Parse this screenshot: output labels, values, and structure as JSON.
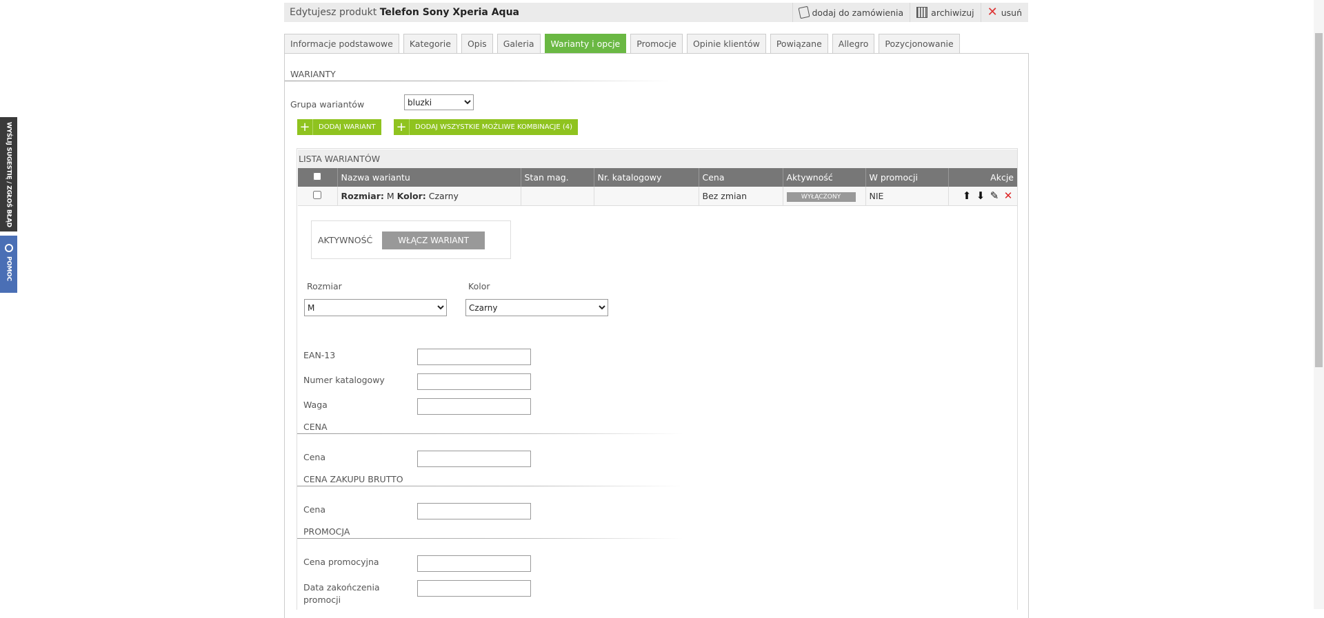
{
  "side": {
    "suggest": "WYŚLIJ SUGESTIĘ / ZGŁOŚ BŁĄD",
    "help": "POMOC"
  },
  "header": {
    "title_prefix": "Edytujesz produkt",
    "product_name": "Telefon Sony Xperia Aqua",
    "actions": {
      "add_order": "dodaj do zamówienia",
      "archive": "archiwizuj",
      "delete": "usuń"
    }
  },
  "tabs": [
    "Informacje podstawowe",
    "Kategorie",
    "Opis",
    "Galeria",
    "Warianty i opcje",
    "Promocje",
    "Opinie klientów",
    "Powiązane",
    "Allegro",
    "Pozycjonowanie"
  ],
  "variants": {
    "heading": "WARIANTY",
    "group_label": "Grupa wariantów",
    "group_value": "bluzki",
    "add_variant": "DODAJ WARIANT",
    "add_all": "DODAJ WSZYSTKIE MOŻLIWE KOMBINACJE (4)"
  },
  "list": {
    "title": "LISTA WARIANTÓW",
    "columns": [
      "Nazwa wariantu",
      "Stan mag.",
      "Nr. katalogowy",
      "Cena",
      "Aktywność",
      "W promocji",
      "Akcje"
    ],
    "row": {
      "size_label": "Rozmiar:",
      "size": "M",
      "color_label": "Kolor:",
      "color": "Czarny",
      "stock": "",
      "catalog": "",
      "price": "Bez zmian",
      "activity": "WYŁĄCZONY",
      "promo": "NIE"
    }
  },
  "detail": {
    "activity_label": "AKTYWNOŚĆ",
    "enable_button": "WŁĄCZ WARIANT",
    "size_label": "Rozmiar",
    "size_value": "M",
    "color_label": "Kolor",
    "color_value": "Czarny",
    "ean_label": "EAN-13",
    "catalog_label": "Numer katalogowy",
    "weight_label": "Waga",
    "price_heading": "CENA",
    "price_label": "Cena",
    "purchase_heading": "CENA ZAKUPU BRUTTO",
    "purchase_label": "Cena",
    "promo_heading": "PROMOCJA",
    "promo_price_label": "Cena promocyjna",
    "promo_end_label_1": "Data zakończenia",
    "promo_end_label_2": "promocji"
  },
  "colors": {
    "accent": "#6ab843",
    "button_green": "#8fc31f",
    "table_header": "#777777"
  }
}
